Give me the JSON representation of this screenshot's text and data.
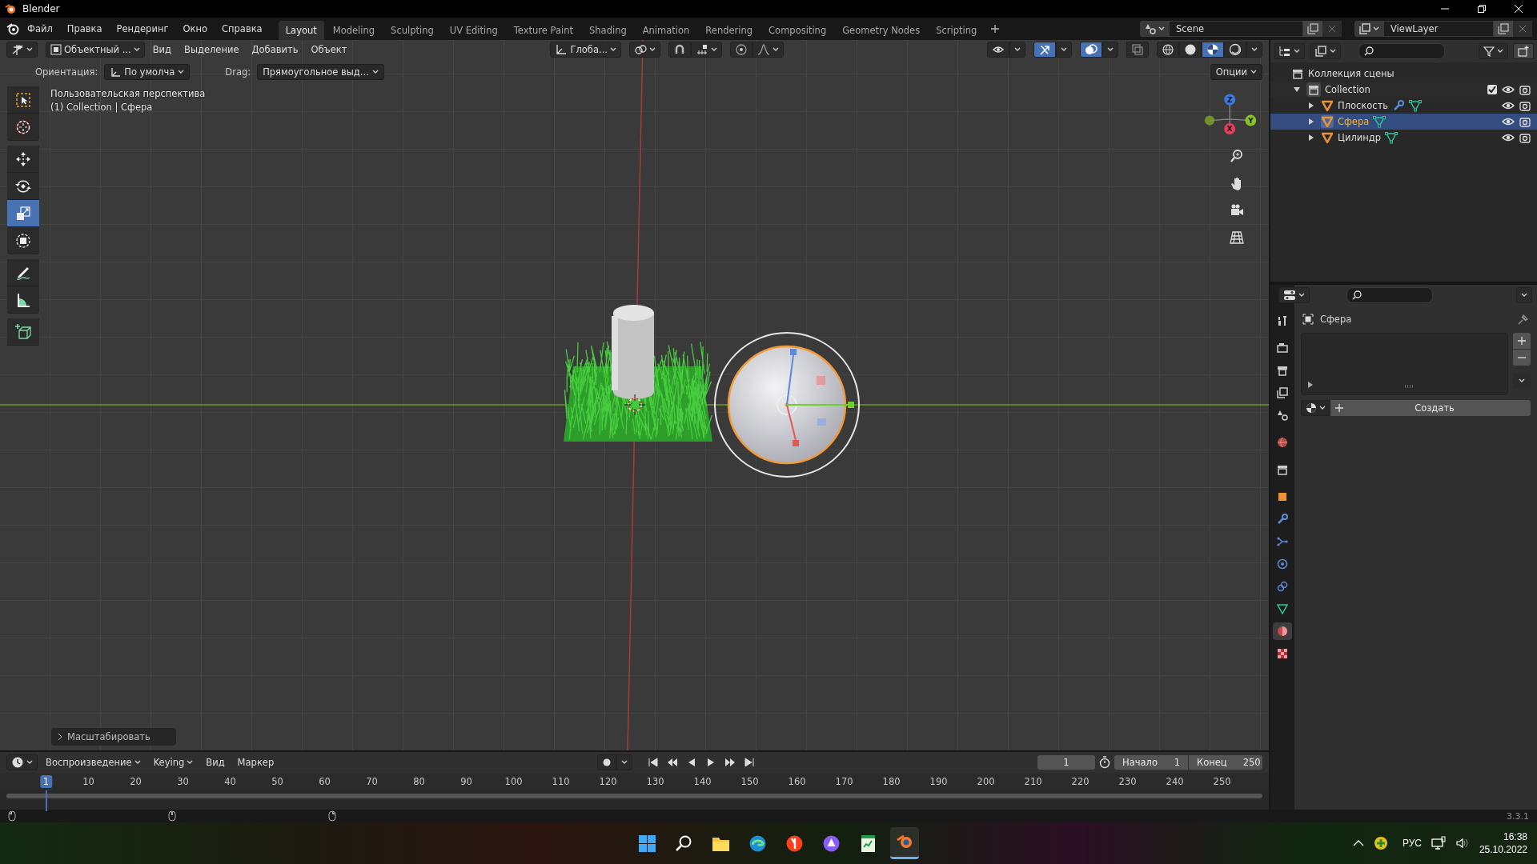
{
  "app_title": "Blender",
  "menu": [
    "Файл",
    "Правка",
    "Рендеринг",
    "Окно",
    "Справка"
  ],
  "workspaces": [
    {
      "label": "Layout",
      "selected": true
    },
    {
      "label": "Modeling",
      "selected": false
    },
    {
      "label": "Sculpting",
      "selected": false
    },
    {
      "label": "UV Editing",
      "selected": false
    },
    {
      "label": "Texture Paint",
      "selected": false
    },
    {
      "label": "Shading",
      "selected": false
    },
    {
      "label": "Animation",
      "selected": false
    },
    {
      "label": "Rendering",
      "selected": false
    },
    {
      "label": "Compositing",
      "selected": false
    },
    {
      "label": "Geometry Nodes",
      "selected": false
    },
    {
      "label": "Scripting",
      "selected": false
    }
  ],
  "scene": "Scene",
  "view_layer": "ViewLayer",
  "viewport_header": {
    "mode": "Объектный ...",
    "menus": [
      "Вид",
      "Выделение",
      "Добавить",
      "Объект"
    ],
    "orientation": "Глоба...",
    "toggles": [
      {
        "kind": "visibility",
        "on": false
      },
      {
        "kind": "gizmo",
        "on": true
      },
      {
        "kind": "overlay",
        "on": true
      },
      {
        "kind": "xray",
        "on": false
      }
    ],
    "shading": [
      {
        "kind": "wireframe",
        "selected": false
      },
      {
        "kind": "solid",
        "selected": false
      },
      {
        "kind": "material",
        "selected": true
      },
      {
        "kind": "rendered",
        "selected": false
      }
    ]
  },
  "tool_settings": {
    "orientation_label": "Ориентация:",
    "orientation": "По умолча",
    "drag_label": "Drag:",
    "drag": "Прямоугольное выд...",
    "options": "Опции"
  },
  "viewport": {
    "view_name": "Пользовательская перспектива",
    "context": "(1) Collection | Сфера",
    "gizmo_axes": [
      "Z",
      "Y",
      "X"
    ],
    "last_operator": "Масштабировать"
  },
  "toolbar": [
    {
      "kind": "select",
      "selected": false
    },
    {
      "kind": "cursor",
      "selected": false
    },
    {
      "kind": "move",
      "selected": false
    },
    {
      "kind": "rotate",
      "selected": false
    },
    {
      "kind": "scale",
      "selected": true
    },
    {
      "kind": "transform",
      "selected": false
    },
    {
      "kind": "annotate",
      "selected": false
    },
    {
      "kind": "measure",
      "selected": false
    },
    {
      "kind": "add_cube",
      "selected": false
    }
  ],
  "outliner": {
    "name": "Коллекция сцены",
    "children": [
      {
        "name": "Collection",
        "expanded": true,
        "checked": true,
        "children": [
          {
            "name": "Плоскость",
            "selected": false,
            "expanded": false,
            "modifier": true
          },
          {
            "name": "Сфера",
            "selected": true,
            "expanded": false,
            "modifier": false
          },
          {
            "name": "Цилиндр",
            "selected": false,
            "expanded": false,
            "modifier": false
          }
        ]
      }
    ]
  },
  "properties": {
    "object": "Сфера",
    "create": "Создать",
    "tabs": [
      {
        "kind": "tool",
        "selected": false
      },
      {
        "kind": "render",
        "selected": false
      },
      {
        "kind": "output",
        "selected": false
      },
      {
        "kind": "view_layer",
        "selected": false
      },
      {
        "kind": "scene",
        "selected": false
      },
      {
        "kind": "world",
        "selected": false
      },
      {
        "kind": "collection",
        "selected": false
      },
      {
        "kind": "object",
        "selected": false
      },
      {
        "kind": "modifiers",
        "selected": false
      },
      {
        "kind": "particles",
        "selected": false
      },
      {
        "kind": "physics",
        "selected": false
      },
      {
        "kind": "constraints",
        "selected": false
      },
      {
        "kind": "data",
        "selected": false
      },
      {
        "kind": "material",
        "selected": true
      },
      {
        "kind": "texture",
        "selected": false
      }
    ]
  },
  "timeline": {
    "menus": [
      "Воспроизведение",
      "Keying",
      "Вид",
      "Маркер"
    ],
    "current_frame": "1",
    "start_label": "Начало",
    "start": "1",
    "end_label": "Конец",
    "end": "250",
    "ruler": [
      {
        "label": "1",
        "selected": true
      },
      {
        "label": "10",
        "selected": false
      },
      {
        "label": "20",
        "selected": false
      },
      {
        "label": "30",
        "selected": false
      },
      {
        "label": "40",
        "selected": false
      },
      {
        "label": "50",
        "selected": false
      },
      {
        "label": "60",
        "selected": false
      },
      {
        "label": "70",
        "selected": false
      },
      {
        "label": "80",
        "selected": false
      },
      {
        "label": "90",
        "selected": false
      },
      {
        "label": "100",
        "selected": false
      },
      {
        "label": "110",
        "selected": false
      },
      {
        "label": "120",
        "selected": false
      },
      {
        "label": "130",
        "selected": false
      },
      {
        "label": "140",
        "selected": false
      },
      {
        "label": "150",
        "selected": false
      },
      {
        "label": "160",
        "selected": false
      },
      {
        "label": "170",
        "selected": false
      },
      {
        "label": "180",
        "selected": false
      },
      {
        "label": "190",
        "selected": false
      },
      {
        "label": "200",
        "selected": false
      },
      {
        "label": "210",
        "selected": false
      },
      {
        "label": "220",
        "selected": false
      },
      {
        "label": "230",
        "selected": false
      },
      {
        "label": "240",
        "selected": false
      },
      {
        "label": "250",
        "selected": false
      }
    ]
  },
  "version": "3.3.1",
  "taskbar": {
    "apps": [
      {
        "kind": "start",
        "selected": false
      },
      {
        "kind": "search",
        "selected": false
      },
      {
        "kind": "files",
        "selected": false
      },
      {
        "kind": "edge",
        "selected": false
      },
      {
        "kind": "yandex",
        "selected": false
      },
      {
        "kind": "purple",
        "selected": false
      },
      {
        "kind": "sheet",
        "selected": false
      },
      {
        "kind": "blender",
        "selected": true
      }
    ],
    "language": "РУС",
    "time": "16:38",
    "date": "25.10.2022"
  }
}
